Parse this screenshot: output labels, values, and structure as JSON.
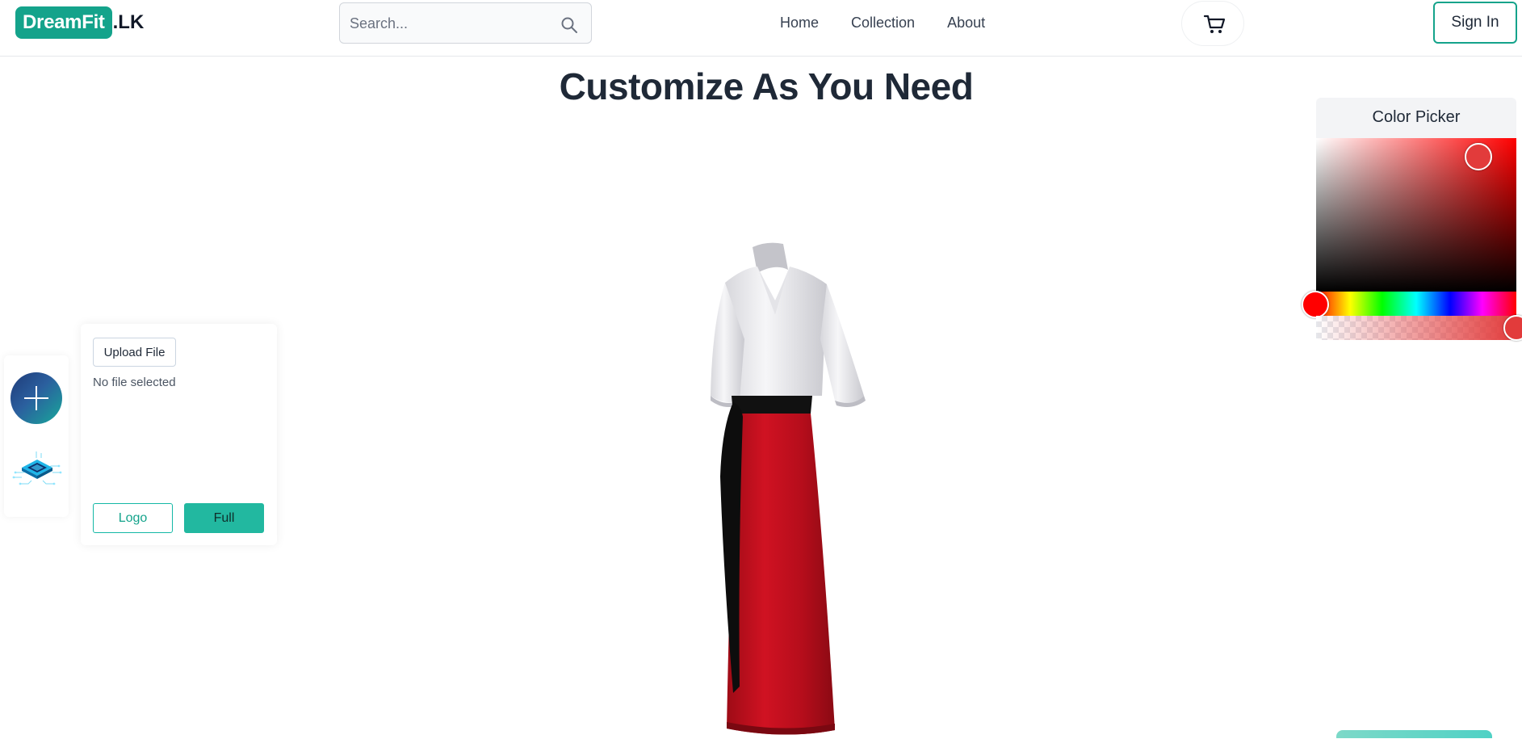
{
  "brand": {
    "badge": "DreamFit",
    "suffix": ".LK"
  },
  "search": {
    "placeholder": "Search...",
    "icon": "search-icon"
  },
  "nav": {
    "items": [
      {
        "label": "Home"
      },
      {
        "label": "Collection"
      },
      {
        "label": "About"
      }
    ]
  },
  "cart": {
    "icon": "cart-icon"
  },
  "auth": {
    "signin_label": "Sign In"
  },
  "page": {
    "title": "Customize As You Need"
  },
  "rail": {
    "add_icon": "plus-icon",
    "chip_icon": "chip-icon"
  },
  "upload": {
    "button_label": "Upload File",
    "status_text": "No file selected",
    "logo_label": "Logo",
    "full_label": "Full"
  },
  "color_picker": {
    "title": "Color Picker",
    "selected_color": "#e23b3b",
    "hue_color": "#ff0000"
  },
  "colors": {
    "accent": "#14a38b",
    "dress_top": "#f3f3f5",
    "dress_skirt": "#c8101e",
    "sash": "#111111"
  }
}
